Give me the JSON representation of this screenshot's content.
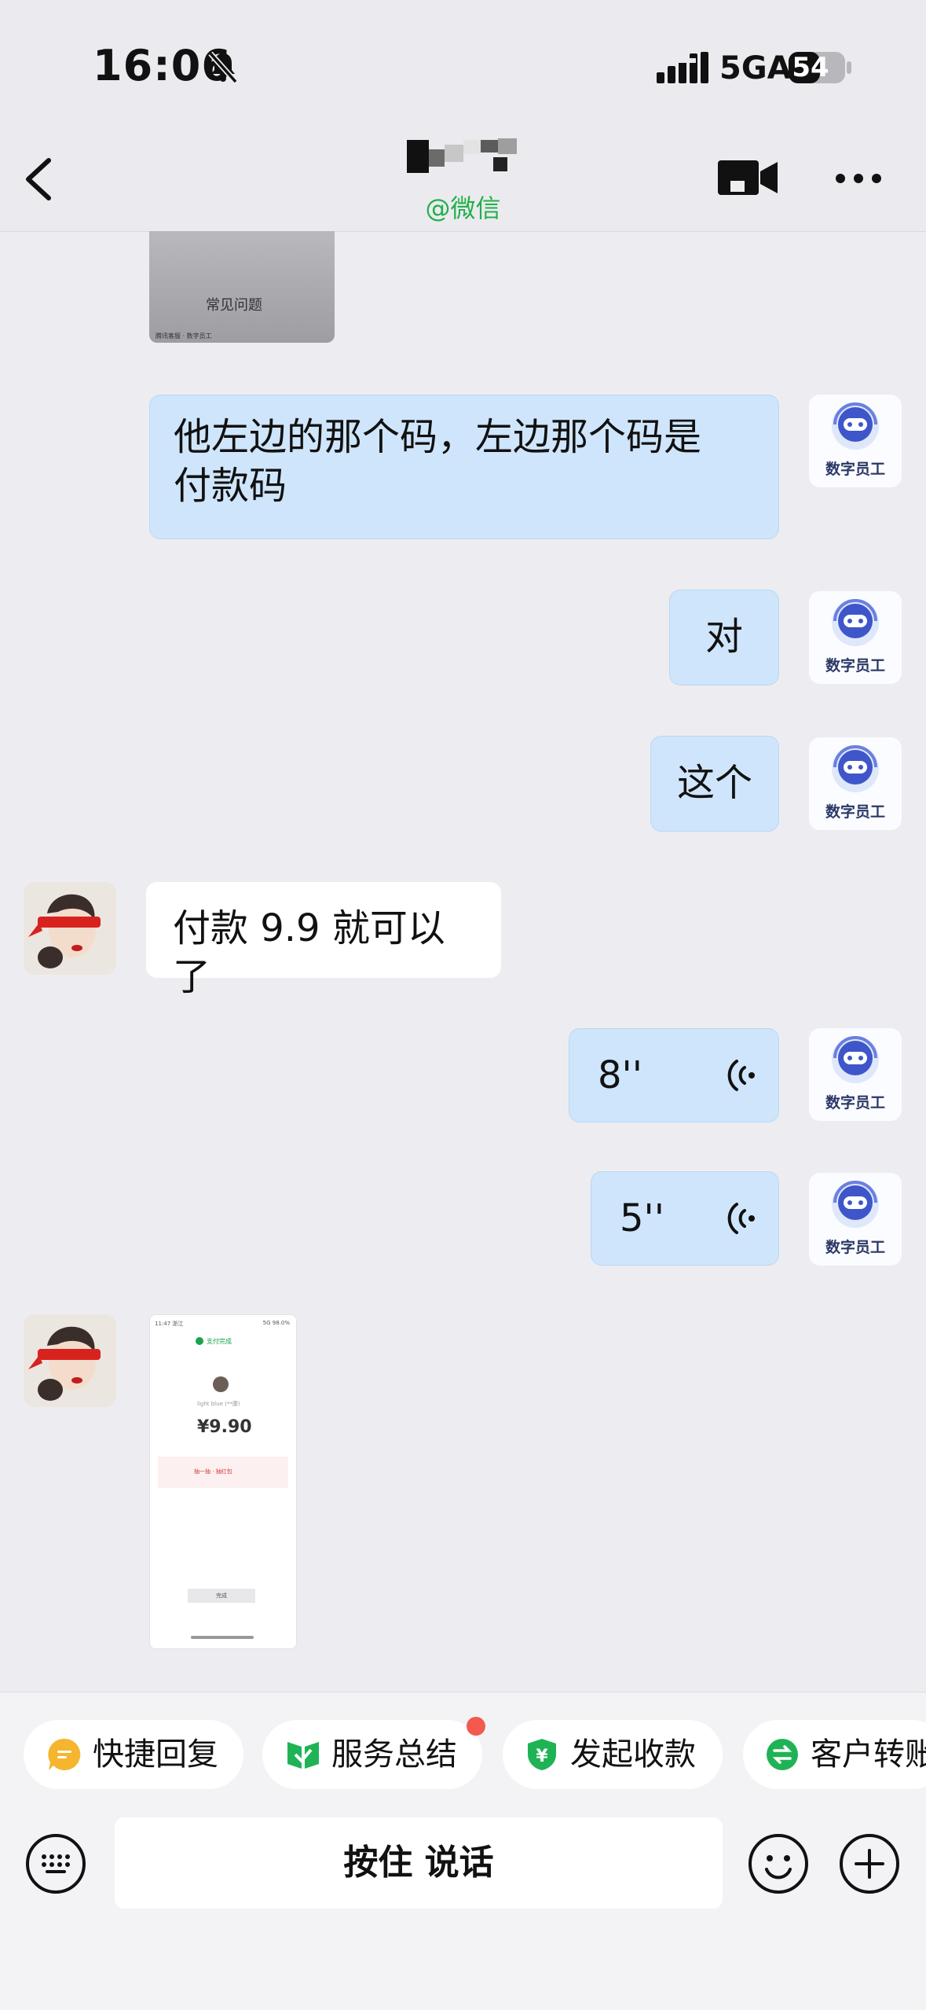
{
  "status_bar": {
    "time": "16:06",
    "network": "5GA",
    "battery": "54"
  },
  "nav": {
    "subtitle": "@微信"
  },
  "images": {
    "shared_card_title": "常见问题",
    "shared_card_footer": "腾讯客服 · 数字员工"
  },
  "messages": [
    {
      "sender": "bot",
      "text": "他左边的那个码，左边那个码是",
      "text2": "付款码"
    },
    {
      "sender": "bot",
      "text": "对"
    },
    {
      "sender": "bot",
      "text": "这个"
    },
    {
      "sender": "user",
      "text": "付款 9.9 就可以了"
    },
    {
      "sender": "bot",
      "type": "voice",
      "duration": "8''"
    },
    {
      "sender": "bot",
      "type": "voice",
      "duration": "5''"
    }
  ],
  "bot_avatar_label": "数字员工",
  "receipt": {
    "time": "11:47 浙江",
    "signal": "5G 98.0%",
    "badge": "支付完成",
    "name": "light blue (**康)",
    "amount": "¥9.90",
    "promo": "抽一抽 · 抽红包",
    "button": "完成"
  },
  "quick_actions": [
    {
      "label": "快捷回复",
      "icon": "quick-reply-icon",
      "color": "#f5b52e"
    },
    {
      "label": "服务总结",
      "icon": "service-summary-icon",
      "color": "#1fb356"
    },
    {
      "label": "发起收款",
      "icon": "collect-payment-icon",
      "color": "#1fb356"
    },
    {
      "label": "客户转账",
      "icon": "customer-transfer-icon",
      "color": "#1fb356"
    }
  ],
  "input": {
    "hold_to_talk": "按住 说话"
  },
  "colors": {
    "bubble_right": "#cfe5fb",
    "bubble_left": "#ffffff",
    "wechat_green": "#22b04a",
    "notify_red": "#f25a4f"
  }
}
